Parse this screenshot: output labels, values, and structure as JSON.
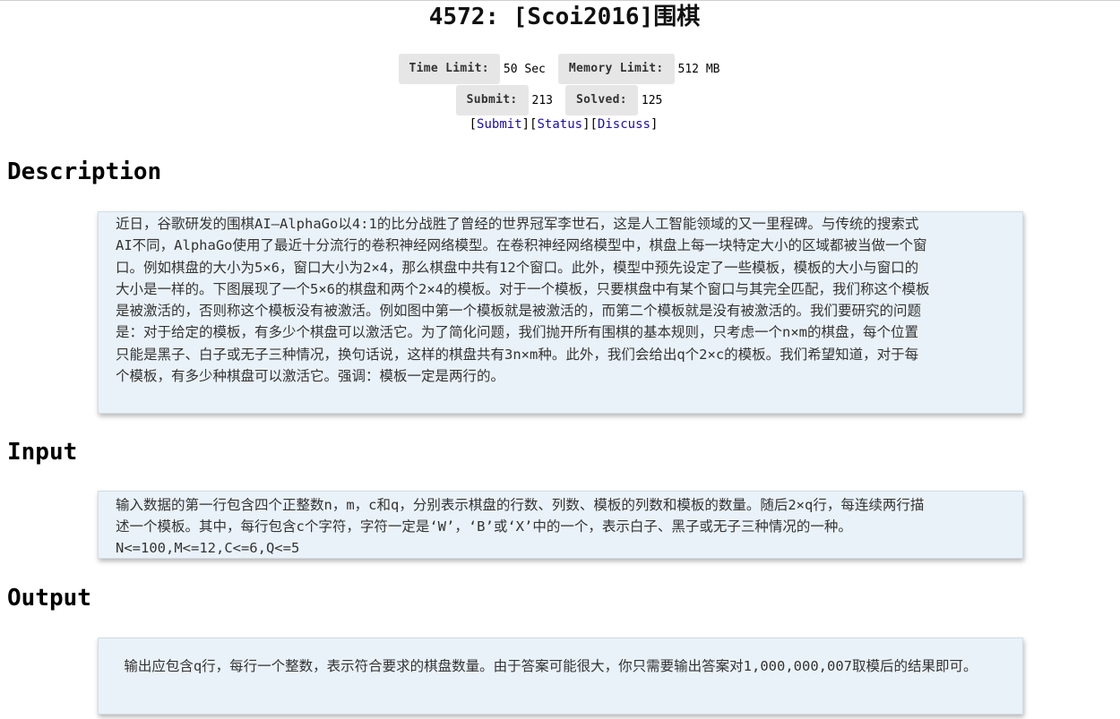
{
  "problem": {
    "title": "4572: [Scoi2016]围棋"
  },
  "limits": {
    "time_label": "Time Limit:",
    "time_value": "50 Sec",
    "memory_label": "Memory Limit:",
    "memory_value": "512 MB",
    "submit_label": "Submit:",
    "submit_value": "213",
    "solved_label": "Solved:",
    "solved_value": "125"
  },
  "links": {
    "submit": "Submit",
    "status": "Status",
    "discuss": "Discuss"
  },
  "sections": {
    "description_heading": "Description",
    "description_text": "近日，谷歌研发的围棋AI—AlphaGo以4:1的比分战胜了曾经的世界冠军李世石，这是人工智能领域的又一里程碑。与传统的搜索式AI不同，AlphaGo使用了最近十分流行的卷积神经网络模型。在卷积神经网络模型中，棋盘上每一块特定大小的区域都被当做一个窗口。例如棋盘的大小为5×6，窗口大小为2×4，那么棋盘中共有12个窗口。此外，模型中预先设定了一些模板，模板的大小与窗口的大小是一样的。下图展现了一个5×6的棋盘和两个2×4的模板。对于一个模板，只要棋盘中有某个窗口与其完全匹配，我们称这个模板是被激活的，否则称这个模板没有被激活。例如图中第一个模板就是被激活的，而第二个模板就是没有被激活的。我们要研究的问题是：对于给定的模板，有多少个棋盘可以激活它。为了简化问题，我们抛开所有围棋的基本规则，只考虑一个n×m的棋盘，每个位置只能是黑子、白子或无子三种情况，换句话说，这样的棋盘共有3n×m种。此外，我们会给出q个2×c的模板。我们希望知道，对于每个模板，有多少种棋盘可以激活它。强调：模板一定是两行的。",
    "input_heading": "Input",
    "input_text": "输入数据的第一行包含四个正整数n，m，c和q，分别表示棋盘的行数、列数、模板的列数和模板的数量。随后2×q行，每连续两行描述一个模板。其中，每行包含c个字符，字符一定是‘W’，‘B’或‘X’中的一个，表示白子、黑子或无子三种情况的一种。N<=100,M<=12,C<=6,Q<=5",
    "output_heading": "Output",
    "output_text": " 输出应包含q行，每行一个整数，表示符合要求的棋盘数量。由于答案可能很大，你只需要输出答案对1,000,000,007取模后的结果即可。"
  }
}
